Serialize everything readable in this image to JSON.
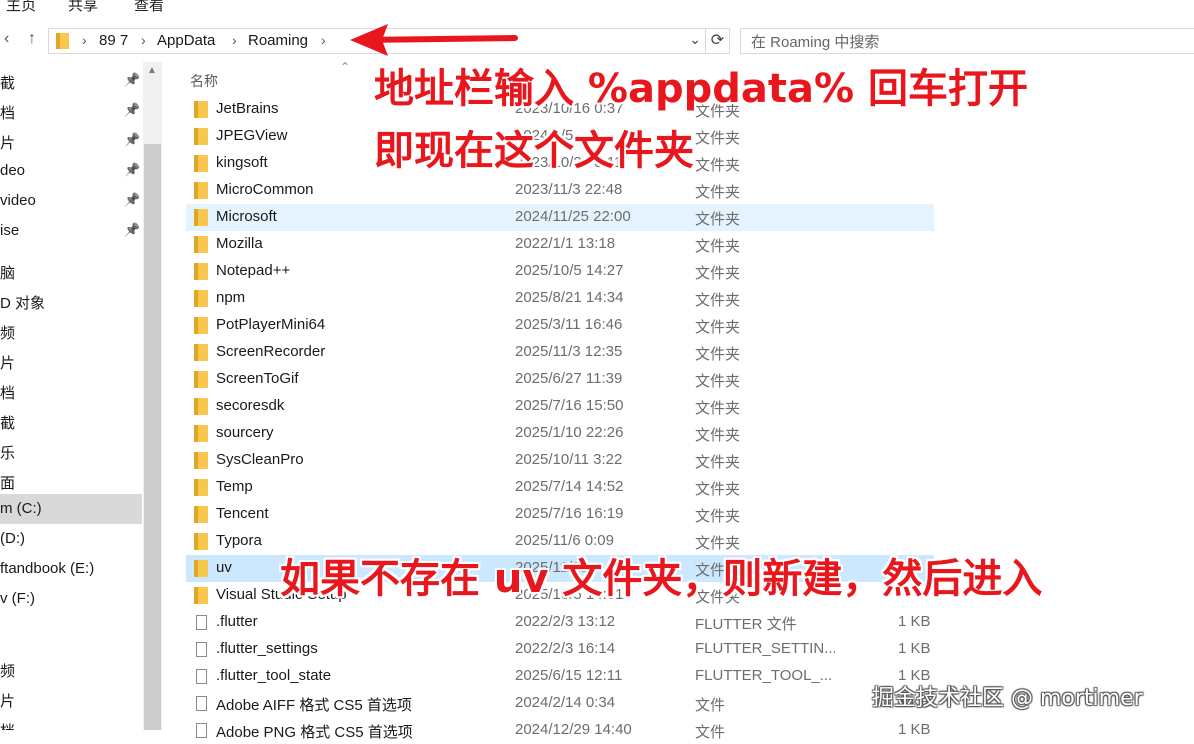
{
  "ribbon": {
    "tabs": [
      "主页",
      "共享",
      "查看"
    ]
  },
  "nav": {
    "back": "‹",
    "up": "↑",
    "breadcrumb": [
      "89 7",
      "AppData",
      "Roaming"
    ],
    "refresh": "⟳",
    "dropdown": "⌄",
    "search_placeholder": "在 Roaming 中搜索"
  },
  "sidebar": {
    "items": [
      {
        "label": "截",
        "pinned": true
      },
      {
        "label": "档",
        "pinned": true
      },
      {
        "label": "片",
        "pinned": true
      },
      {
        "label": "deo",
        "pinned": true
      },
      {
        "label": "video",
        "pinned": true
      },
      {
        "label": "ise",
        "pinned": true
      },
      {
        "label": "脑",
        "pinned": false
      },
      {
        "label": "D 对象",
        "pinned": false
      },
      {
        "label": "频",
        "pinned": false
      },
      {
        "label": "片",
        "pinned": false
      },
      {
        "label": "档",
        "pinned": false
      },
      {
        "label": "截",
        "pinned": false
      },
      {
        "label": "乐",
        "pinned": false
      },
      {
        "label": "面",
        "pinned": false
      },
      {
        "label": "m (C:)",
        "pinned": false,
        "selected": true
      },
      {
        "label": "(D:)",
        "pinned": false
      },
      {
        "label": "ftandbook (E:)",
        "pinned": false
      },
      {
        "label": "v (F:)",
        "pinned": false
      },
      {
        "label": "",
        "pinned": false
      },
      {
        "label": "频",
        "pinned": false
      },
      {
        "label": "片",
        "pinned": false
      },
      {
        "label": "档",
        "pinned": false
      }
    ]
  },
  "list": {
    "header_name": "名称",
    "rows": [
      {
        "name": "JetBrains",
        "date": "2023/10/16 0:37",
        "type": "文件夹",
        "size": "",
        "kind": "folder"
      },
      {
        "name": "JPEGView",
        "date": "2024/1/5",
        "type": "文件夹",
        "size": "",
        "kind": "folder"
      },
      {
        "name": "kingsoft",
        "date": "2023/10/29 8:11",
        "type": "文件夹",
        "size": "",
        "kind": "folder"
      },
      {
        "name": "MicroCommon",
        "date": "2023/11/3 22:48",
        "type": "文件夹",
        "size": "",
        "kind": "folder"
      },
      {
        "name": "Microsoft",
        "date": "2024/11/25 22:00",
        "type": "文件夹",
        "size": "",
        "kind": "folder",
        "state": "sel"
      },
      {
        "name": "Mozilla",
        "date": "2022/1/1 13:18",
        "type": "文件夹",
        "size": "",
        "kind": "folder"
      },
      {
        "name": "Notepad++",
        "date": "2025/10/5 14:27",
        "type": "文件夹",
        "size": "",
        "kind": "folder"
      },
      {
        "name": "npm",
        "date": "2025/8/21 14:34",
        "type": "文件夹",
        "size": "",
        "kind": "folder"
      },
      {
        "name": "PotPlayerMini64",
        "date": "2025/3/11 16:46",
        "type": "文件夹",
        "size": "",
        "kind": "folder"
      },
      {
        "name": "ScreenRecorder",
        "date": "2025/11/3 12:35",
        "type": "文件夹",
        "size": "",
        "kind": "folder"
      },
      {
        "name": "ScreenToGif",
        "date": "2025/6/27 11:39",
        "type": "文件夹",
        "size": "",
        "kind": "folder"
      },
      {
        "name": "secoresdk",
        "date": "2025/7/16 15:50",
        "type": "文件夹",
        "size": "",
        "kind": "folder"
      },
      {
        "name": "sourcery",
        "date": "2025/1/10 22:26",
        "type": "文件夹",
        "size": "",
        "kind": "folder"
      },
      {
        "name": "SysCleanPro",
        "date": "2025/10/11 3:22",
        "type": "文件夹",
        "size": "",
        "kind": "folder"
      },
      {
        "name": "Temp",
        "date": "2025/7/14 14:52",
        "type": "文件夹",
        "size": "",
        "kind": "folder"
      },
      {
        "name": "Tencent",
        "date": "2025/7/16 16:19",
        "type": "文件夹",
        "size": "",
        "kind": "folder"
      },
      {
        "name": "Typora",
        "date": "2025/11/6 0:09",
        "type": "文件夹",
        "size": "",
        "kind": "folder"
      },
      {
        "name": "uv",
        "date": "2025/11/21",
        "type": "文件夹",
        "size": "",
        "kind": "folder",
        "state": "hl"
      },
      {
        "name": "Visual Studio Setup",
        "date": "2025/10/5 14:01",
        "type": "文件夹",
        "size": "",
        "kind": "folder"
      },
      {
        "name": ".flutter",
        "date": "2022/2/3 13:12",
        "type": "FLUTTER 文件",
        "size": "1 KB",
        "kind": "file"
      },
      {
        "name": ".flutter_settings",
        "date": "2022/2/3 16:14",
        "type": "FLUTTER_SETTIN...",
        "size": "1 KB",
        "kind": "file"
      },
      {
        "name": ".flutter_tool_state",
        "date": "2025/6/15 12:11",
        "type": "FLUTTER_TOOL_...",
        "size": "1 KB",
        "kind": "file"
      },
      {
        "name": "Adobe AIFF 格式 CS5 首选项",
        "date": "2024/2/14 0:34",
        "type": "文件",
        "size": "1 KB",
        "kind": "file"
      },
      {
        "name": "Adobe PNG 格式 CS5 首选项",
        "date": "2024/12/29 14:40",
        "type": "文件",
        "size": "1 KB",
        "kind": "file"
      }
    ]
  },
  "annotations": {
    "line1": "地址栏输入 %appdata% 回车打开",
    "line2": "即现在这个文件夹",
    "line3": "如果不存在 uv 文件夹，则新建，然后进入",
    "accent": "#e8171d"
  },
  "watermark": "掘金技术社区 @ mortimer"
}
